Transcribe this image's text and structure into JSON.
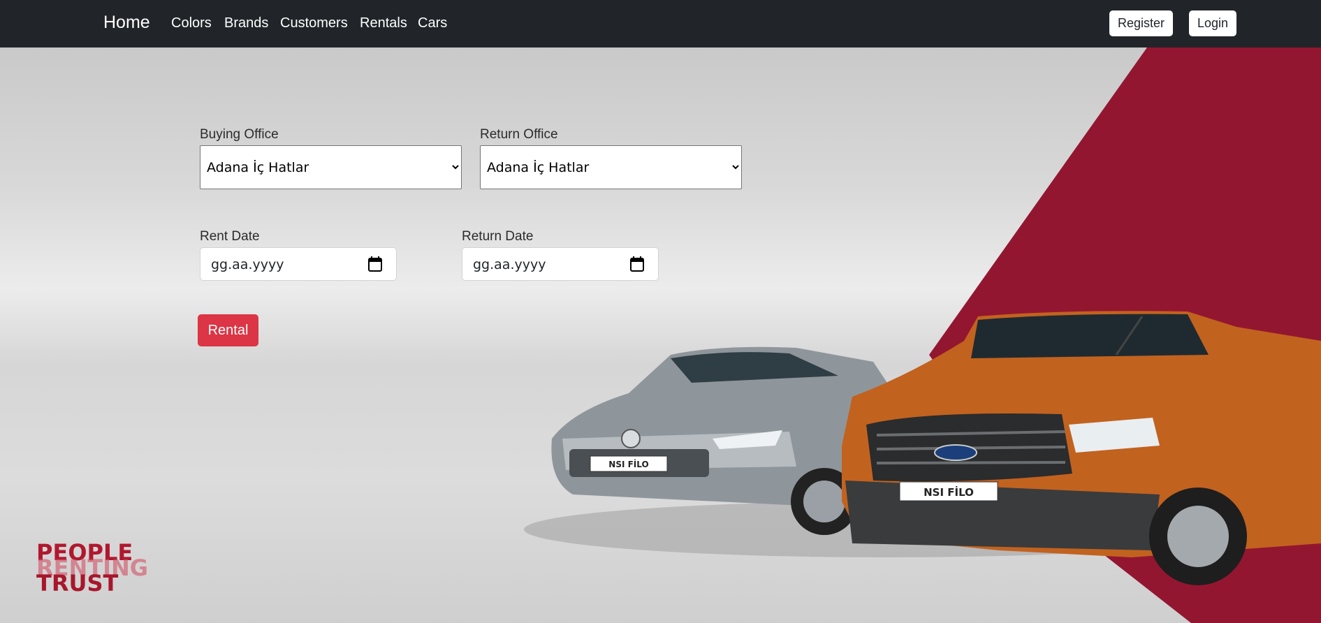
{
  "navbar": {
    "brand": "Home",
    "links": [
      "Colors",
      "Brands",
      "Customers",
      "Rentals",
      "Cars"
    ],
    "register_label": "Register",
    "login_label": "Login"
  },
  "form": {
    "buying_office": {
      "label": "Buying Office",
      "selected": "Adana İç Hatlar"
    },
    "return_office": {
      "label": "Return Office",
      "selected": "Adana İç Hatlar"
    },
    "rent_date": {
      "label": "Rent Date",
      "placeholder": "gg.aa.yyyy"
    },
    "return_date": {
      "label": "Return Date",
      "placeholder": "gg.aa.yyyy"
    },
    "submit_label": "Rental"
  },
  "hero": {
    "tagline": [
      "PEOPLE",
      "RENTING",
      "TRUST"
    ],
    "plate_text": "NSI FİLO",
    "colors": {
      "accent": "#931630",
      "button": "#dc3545",
      "navbar": "#212529"
    }
  }
}
